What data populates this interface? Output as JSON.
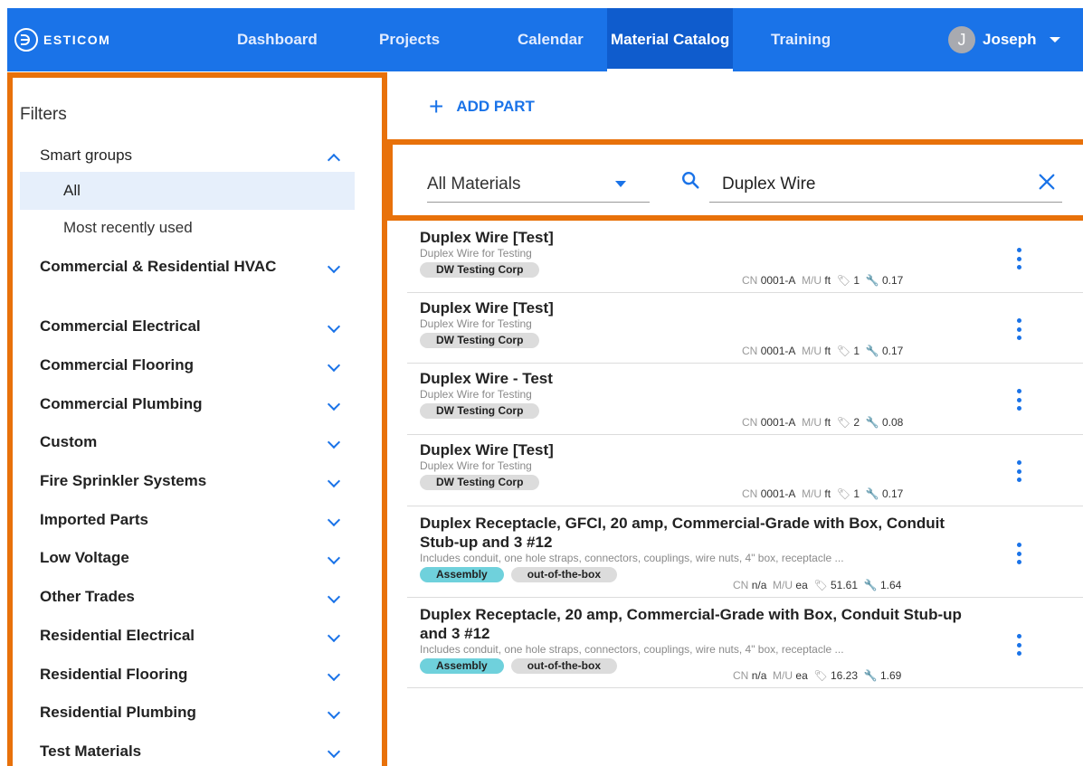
{
  "brand": {
    "name": "ESTICOM"
  },
  "nav": {
    "items": [
      "Dashboard",
      "Projects",
      "Calendar",
      "Material Catalog",
      "Training"
    ],
    "active": "Material Catalog",
    "user": {
      "initial": "J",
      "name": "Joseph"
    }
  },
  "filters": {
    "title": "Filters",
    "smart_groups": {
      "label": "Smart groups",
      "items": [
        "All",
        "Most recently used"
      ],
      "selected": "All"
    },
    "groups": [
      "Commercial & Residential HVAC",
      "Commercial Electrical",
      "Commercial Flooring",
      "Commercial Plumbing",
      "Custom",
      "Fire Sprinkler Systems",
      "Imported Parts",
      "Low Voltage",
      "Other Trades",
      "Residential Electrical",
      "Residential Flooring",
      "Residential Plumbing",
      "Test Materials"
    ]
  },
  "toolbar": {
    "add_part_label": "ADD PART"
  },
  "search": {
    "category": "All Materials",
    "query": "Duplex Wire"
  },
  "results": [
    {
      "title": "Duplex Wire [Test]",
      "desc": "Duplex Wire for Testing",
      "tags": [
        "DW Testing Corp"
      ],
      "cn_label": "CN",
      "cn": "0001-A",
      "mu_label": "M/U",
      "mu": "ft",
      "cost": "1",
      "labor": "0.17"
    },
    {
      "title": "Duplex Wire [Test]",
      "desc": "Duplex Wire for Testing",
      "tags": [
        "DW Testing Corp"
      ],
      "cn_label": "CN",
      "cn": "0001-A",
      "mu_label": "M/U",
      "mu": "ft",
      "cost": "1",
      "labor": "0.17"
    },
    {
      "title": "Duplex Wire - Test",
      "desc": "Duplex Wire for Testing",
      "tags": [
        "DW Testing Corp"
      ],
      "cn_label": "CN",
      "cn": "0001-A",
      "mu_label": "M/U",
      "mu": "ft",
      "cost": "2",
      "labor": "0.08"
    },
    {
      "title": "Duplex Wire [Test]",
      "desc": "Duplex Wire for Testing",
      "tags": [
        "DW Testing Corp"
      ],
      "cn_label": "CN",
      "cn": "0001-A",
      "mu_label": "M/U",
      "mu": "ft",
      "cost": "1",
      "labor": "0.17"
    },
    {
      "title": "Duplex Receptacle, GFCI, 20 amp, Commercial-Grade with Box, Conduit Stub-up and 3 #12",
      "desc": "Includes conduit, one hole straps, connectors, couplings, wire nuts, 4\" box, receptacle ...",
      "tags": [
        "Assembly",
        "out-of-the-box"
      ],
      "cn_label": "CN",
      "cn": "n/a",
      "mu_label": "M/U",
      "mu": "ea",
      "cost": "51.61",
      "labor": "1.64"
    },
    {
      "title": "Duplex Receptacle, 20 amp, Commercial-Grade with Box, Conduit Stub-up and 3 #12",
      "desc": "Includes conduit, one hole straps, connectors, couplings, wire nuts, 4\" box, receptacle ...",
      "tags": [
        "Assembly",
        "out-of-the-box"
      ],
      "cn_label": "CN",
      "cn": "n/a",
      "mu_label": "M/U",
      "mu": "ea",
      "cost": "16.23",
      "labor": "1.69"
    }
  ],
  "colors": {
    "primary": "#1a73e8",
    "highlight": "#e8710a",
    "assembly_tag": "#6fd1dc"
  }
}
